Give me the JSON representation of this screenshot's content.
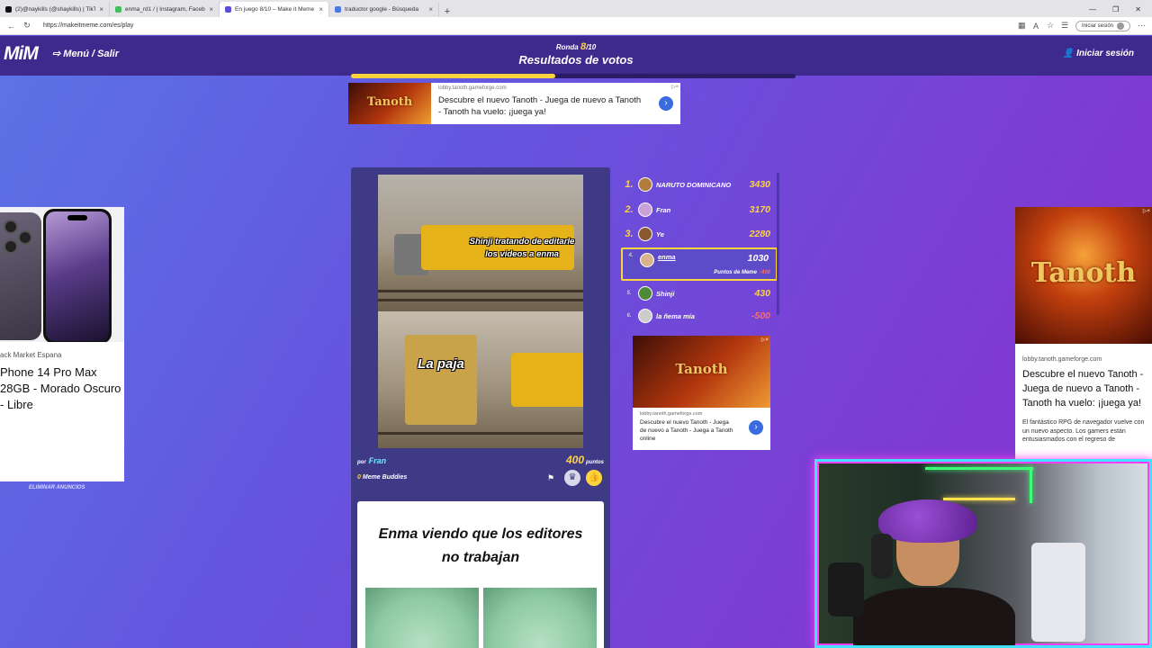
{
  "browser": {
    "tabs": [
      {
        "label": "(2)@naykills (@shaykills) | TikTok",
        "active": false,
        "color": "#111111"
      },
      {
        "label": "enma_rd1 / | Instagram, Facebook",
        "active": false,
        "color": "#3fbf5f"
      },
      {
        "label": "En juego 8/10 – Make it Meme",
        "active": true,
        "color": "#5a4fd8"
      },
      {
        "label": "traductor google - Búsqueda",
        "active": false,
        "color": "#4a7ae0"
      }
    ],
    "url": "https://makeitmeme.com/es/play",
    "signin": "Iniciar sesión"
  },
  "header": {
    "logo": "MiM",
    "menu_exit": "Menú / Salir",
    "round_label": "Ronda",
    "round_current": "8",
    "round_total": "/10",
    "title": "Resultados de votos",
    "login": "Iniciar sesión",
    "progress": 0.46,
    "accent": "#ffd33d"
  },
  "ads": {
    "top": {
      "domain": "lobby.tanoth.gameforge.com",
      "headline": "Descubre el nuevo Tanoth - Juega de nuevo a Tanoth - Tanoth ha vuelo: ¡juega ya!",
      "logo": "Tanoth"
    },
    "left": {
      "store": "ack Market Espana",
      "title": "Phone 14 Pro Max 28GB - Morado Oscuro - Libre"
    },
    "remove": "ELIMINAR ANUNCIOS",
    "mid": {
      "logo": "Tanoth",
      "domain": "lobby.tanoth.gameforge.com",
      "headline": "Descubre el nuevo Tanoth - Juega de nuevo a Tanoth - Juega a Tanoth online"
    },
    "right": {
      "logo": "Tanoth",
      "domain": "lobby.tanoth.gameforge.com",
      "headline": "Descubre el nuevo Tanoth - Juega de nuevo a Tanoth - Tanoth ha vuelo: ¡juega ya!",
      "desc": "El fantástico RPG de navegador vuelve con un nuevo aspecto. Los gamers están entusiasmados con el regreso de"
    }
  },
  "meme": {
    "caption_top": "Shinji tratando de editarle los videos a enma",
    "caption_bottom": "La paja",
    "por": "por",
    "author": "Fran",
    "points": "400",
    "points_label": "puntos",
    "buddies_count": "0",
    "buddies_label": "Meme Buddies"
  },
  "next_meme": {
    "title": "Enma viendo que los editores no trabajan"
  },
  "leaderboard": [
    {
      "rank": "1.",
      "name": "NARUTO DOMINICANO",
      "score": "3430"
    },
    {
      "rank": "2.",
      "name": "Fran",
      "score": "3170"
    },
    {
      "rank": "3.",
      "name": "Ye",
      "score": "2280"
    },
    {
      "rank": "4.",
      "name": "enma",
      "score": "1030",
      "sub": "Puntos de Meme",
      "delta": "-400"
    },
    {
      "rank": "5.",
      "name": "Shinji",
      "score": "430"
    },
    {
      "rank": "6.",
      "name": "la ñema mía",
      "score": "-500"
    }
  ]
}
